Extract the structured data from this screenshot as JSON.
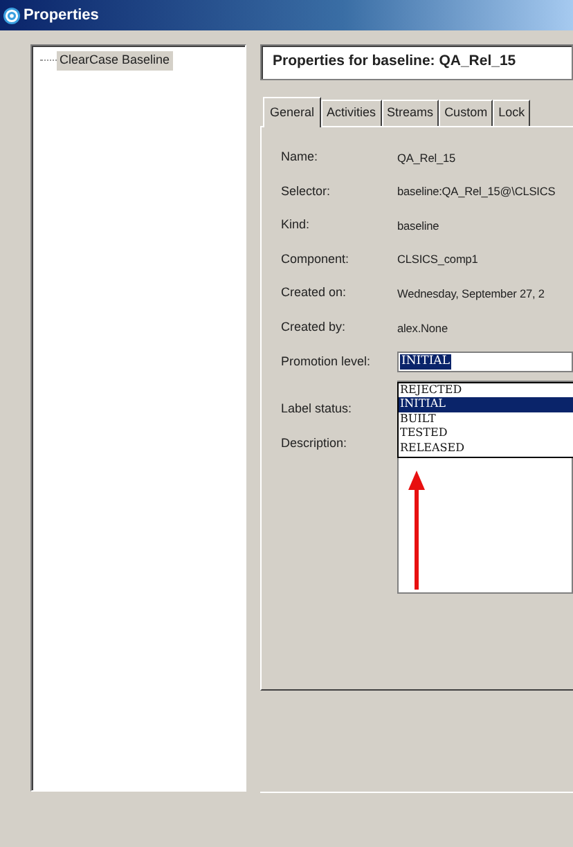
{
  "window": {
    "title": "Properties"
  },
  "tree": {
    "items": [
      {
        "label": "ClearCase Baseline",
        "selected": true
      }
    ]
  },
  "header": "Properties for baseline: QA_Rel_15",
  "tabs": [
    {
      "label": "General",
      "selected": true
    },
    {
      "label": "Activities",
      "selected": false
    },
    {
      "label": "Streams",
      "selected": false
    },
    {
      "label": "Custom",
      "selected": false
    },
    {
      "label": "Lock",
      "selected": false
    }
  ],
  "fields": [
    {
      "label": "Name:",
      "value": "QA_Rel_15"
    },
    {
      "label": "Selector:",
      "value": "baseline:QA_Rel_15@\\CLSICS"
    },
    {
      "label": "Kind:",
      "value": "baseline"
    },
    {
      "label": "Component:",
      "value": "CLSICS_comp1"
    },
    {
      "label": "Created on:",
      "value": "Wednesday, September 27, 2"
    },
    {
      "label": "Created by:",
      "value": "alex.None"
    }
  ],
  "promotion": {
    "label": "Promotion level:",
    "value": "INITIAL",
    "options": [
      {
        "label": "REJECTED",
        "selected": false
      },
      {
        "label": "INITIAL",
        "selected": true
      },
      {
        "label": "BUILT",
        "selected": false
      },
      {
        "label": "TESTED",
        "selected": false
      },
      {
        "label": "RELEASED",
        "selected": false
      }
    ]
  },
  "label_status": {
    "label": "Label status:"
  },
  "description": {
    "label": "Description:"
  }
}
